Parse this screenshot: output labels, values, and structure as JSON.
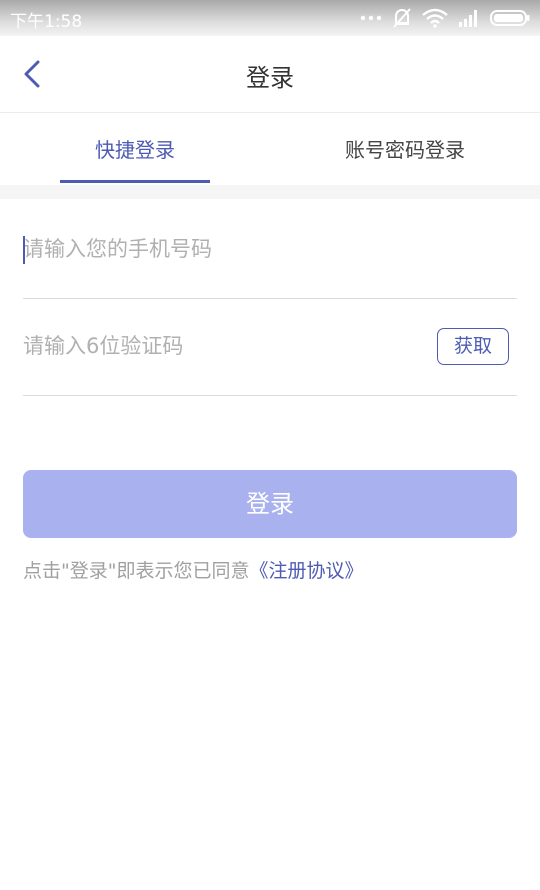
{
  "status_bar": {
    "time": "下午1:58",
    "icons": [
      "more-dots-icon",
      "mute-icon",
      "wifi-icon",
      "signal-icon",
      "battery-icon"
    ]
  },
  "header": {
    "title": "登录",
    "back_icon": "chevron-left-icon"
  },
  "tabs": [
    {
      "label": "快捷登录",
      "active": true
    },
    {
      "label": "账号密码登录",
      "active": false
    }
  ],
  "form": {
    "phone_placeholder": "请输入您的手机号码",
    "phone_value": "",
    "code_placeholder": "请输入6位验证码",
    "code_value": "",
    "get_code_label": "获取",
    "login_label": "登录"
  },
  "agreement": {
    "prefix": "点击\"登录\"即表示您已同意",
    "link": "《注册协议》"
  },
  "colors": {
    "accent": "#4d5bb3",
    "button_disabled": "#a9b2ee",
    "placeholder": "#b0b0b0"
  }
}
